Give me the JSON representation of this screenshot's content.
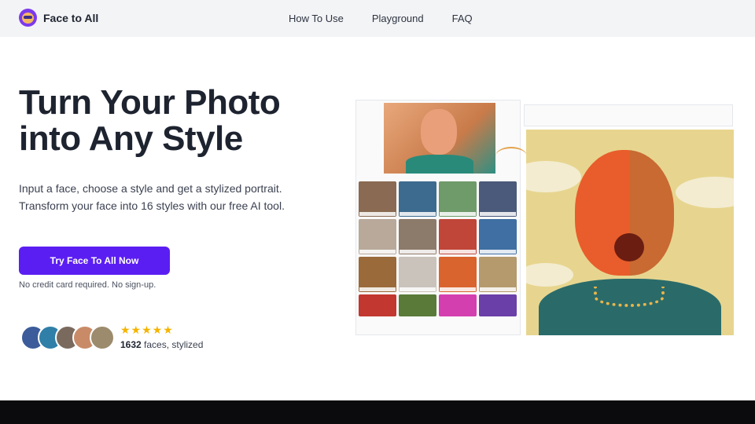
{
  "nav": {
    "brand": "Face to All",
    "links": [
      "How To Use",
      "Playground",
      "FAQ"
    ]
  },
  "hero": {
    "title_line1": "Turn Your Photo",
    "title_line2": "into Any Style",
    "subtitle_line1": "Input a face, choose a style and get a stylized portrait.",
    "subtitle_line2": "Transform your face into 16 styles with our free AI tool.",
    "cta": "Try Face To All Now",
    "note": "No credit card required. No sign-up."
  },
  "social": {
    "stars": "★★★★★",
    "count": "1632",
    "count_suffix": " faces, stylized"
  },
  "colors": {
    "accent": "#5b1ef2",
    "star": "#f5b400",
    "nav_bg": "#f3f4f6"
  }
}
